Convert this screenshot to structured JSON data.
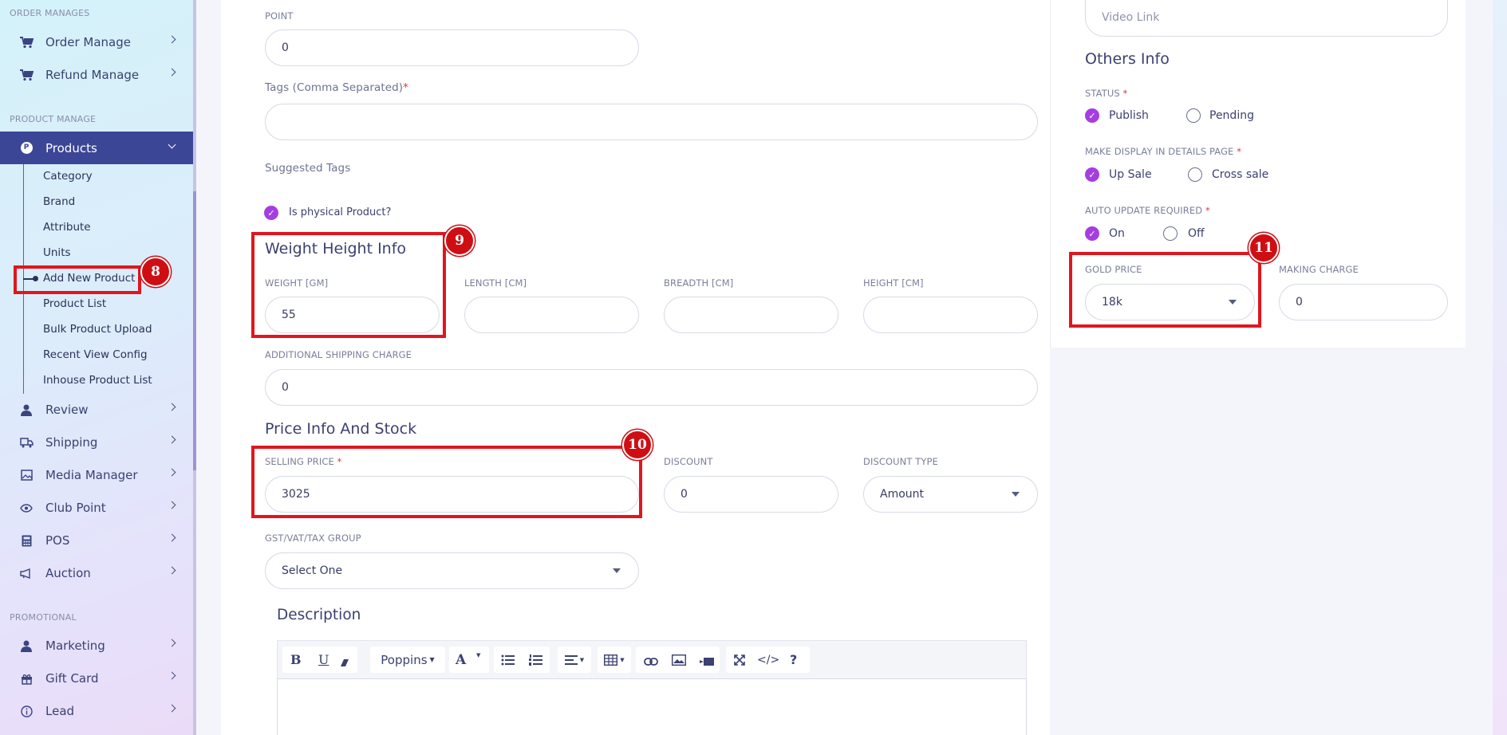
{
  "sidebar": {
    "sections": {
      "order_manages": "ORDER MANAGES",
      "product_manage": "PRODUCT MANAGE",
      "promotional": "PROMOTIONAL"
    },
    "order_manage": "Order Manage",
    "refund_manage": "Refund Manage",
    "products": "Products",
    "products_badge": "P",
    "sub_items": [
      "Category",
      "Brand",
      "Attribute",
      "Units",
      "Add New Product",
      "Product List",
      "Bulk Product Upload",
      "Recent View Config",
      "Inhouse Product List"
    ],
    "review": "Review",
    "shipping": "Shipping",
    "media_manager": "Media Manager",
    "club_point": "Club Point",
    "pos": "POS",
    "auction": "Auction",
    "marketing": "Marketing",
    "gift_card": "Gift Card",
    "lead": "Lead"
  },
  "form": {
    "point_label": "POINT",
    "point_value": "0",
    "tags_label": "Tags (Comma Separated)",
    "required_mark": "*",
    "tags_value": "",
    "suggested_tags": "Suggested Tags",
    "is_physical": "Is physical Product?",
    "weight_heading": "Weight Height Info",
    "weight_label": "WEIGHT [GM]",
    "weight_value": "55",
    "length_label": "LENGTH [CM]",
    "breadth_label": "BREADTH [CM]",
    "height_label": "HEIGHT [CM]",
    "shipping_label": "ADDITIONAL SHIPPING CHARGE",
    "shipping_value": "0",
    "price_heading": "Price Info And Stock",
    "selling_label": "SELLING PRICE",
    "selling_value": "3025",
    "discount_label": "DISCOUNT",
    "discount_value": "0",
    "discount_type_label": "DISCOUNT TYPE",
    "discount_type_value": "Amount",
    "gst_label": "GST/VAT/TAX GROUP",
    "gst_value": "Select One",
    "description_heading": "Description"
  },
  "editor": {
    "bold": "B",
    "underline": "U",
    "font_name": "Poppins",
    "font_color": "A",
    "code": "</>",
    "help": "?"
  },
  "right_panel": {
    "video_link_placeholder": "Video Link",
    "others_heading": "Others Info",
    "status_label": "STATUS",
    "publish": "Publish",
    "pending": "Pending",
    "display_label": "MAKE DISPLAY IN DETAILS PAGE",
    "up_sale": "Up Sale",
    "cross_sale": "Cross sale",
    "auto_update_label": "AUTO UPDATE REQUIRED",
    "on": "On",
    "off": "Off",
    "gold_price_label": "GOLD PRICE",
    "gold_price_value": "18k",
    "making_charge_label": "MAKING CHARGE",
    "making_charge_value": "0"
  },
  "annotations": [
    "8",
    "9",
    "10",
    "11"
  ],
  "colors": {
    "accent": "#a53ee0",
    "sidebar_active": "#3c4696",
    "highlight": "#e0161f"
  }
}
